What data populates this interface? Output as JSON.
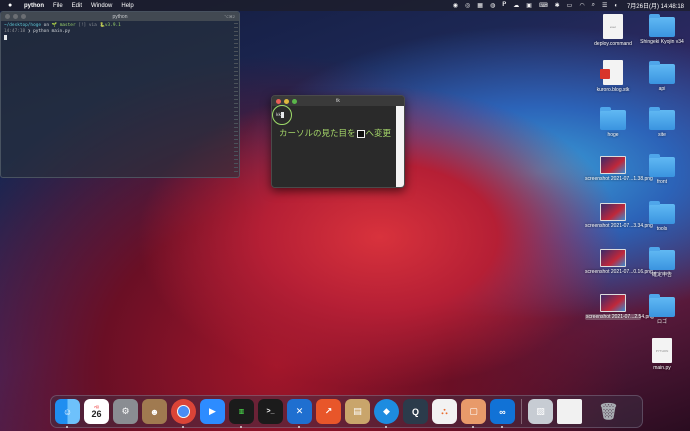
{
  "menubar": {
    "app_name": "python",
    "menus": [
      "File",
      "Edit",
      "Window",
      "Help"
    ],
    "clock": "7月26日(月)  14:48:18"
  },
  "terminal": {
    "title": "python",
    "shortcut": "⌥⌘2",
    "line1_path": "~/desktop/hoge",
    "line1_on": "on",
    "line1_branch": "🌱 master",
    "line1_status": "[!] via",
    "line1_version": "🐍v3.9.1",
    "line2_time": "14:47:18",
    "line2_cmd": "❯ python main.py"
  },
  "tk_window": {
    "title": "tk",
    "entry_text": "kk",
    "label_before": "カーソルの見た目を",
    "label_after": "へ変更"
  },
  "desktop_icons": [
    {
      "label": "deploy.command",
      "kind": "doc",
      "doc_text": "exec"
    },
    {
      "label": "Shingeki Kyojin v34",
      "kind": "folder"
    },
    {
      "label": "kuroro.blog.stk",
      "kind": "doc-red"
    },
    {
      "label": "api",
      "kind": "folder"
    },
    {
      "label": "hoge",
      "kind": "folder"
    },
    {
      "label": "site",
      "kind": "folder"
    },
    {
      "label": "screenshot 2021-07...1.38.png",
      "kind": "thumb"
    },
    {
      "label": "front",
      "kind": "folder"
    },
    {
      "label": "screenshot 2021-07...3.34.png",
      "kind": "thumb"
    },
    {
      "label": "tools",
      "kind": "folder"
    },
    {
      "label": "screenshot 2021-07...0.16.png",
      "kind": "thumb"
    },
    {
      "label": "確定申告",
      "kind": "folder"
    },
    {
      "label": "screenshot 2021-07...2.54.png",
      "kind": "thumb"
    },
    {
      "label": "ロゴ",
      "kind": "folder"
    },
    {
      "label": "main.py",
      "kind": "doc",
      "doc_text": "PYTHON"
    }
  ],
  "dock": {
    "calendar_month": "7月",
    "calendar_day": "26",
    "terminal_glyph": ">_"
  },
  "colors": {
    "terminal_path": "#5ec9d6",
    "terminal_branch": "#9bd36a",
    "tk_label": "#a6d86a",
    "folder_blue": "#3a94e0"
  }
}
